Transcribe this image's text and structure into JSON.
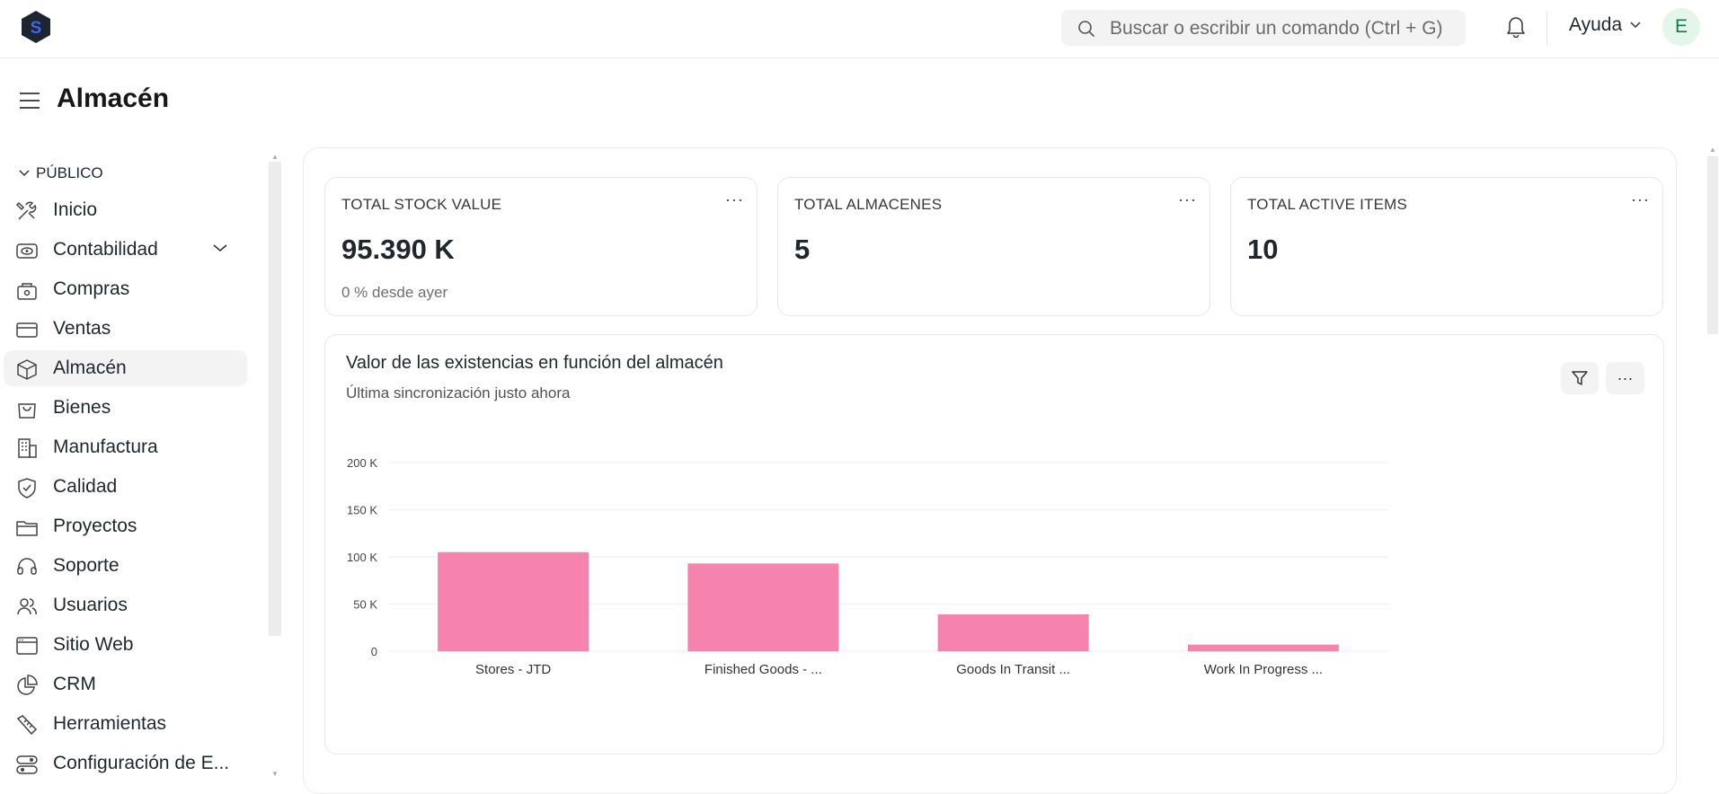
{
  "topbar": {
    "search_placeholder": "Buscar o escribir un comando (Ctrl + G)",
    "help_label": "Ayuda",
    "avatar_initial": "E"
  },
  "page": {
    "title": "Almacén"
  },
  "sidebar": {
    "section_label": "PÚBLICO",
    "items": [
      {
        "label": "Inicio",
        "icon": "tools-icon"
      },
      {
        "label": "Contabilidad",
        "icon": "eye-icon",
        "expandable": true
      },
      {
        "label": "Compras",
        "icon": "shopping-icon"
      },
      {
        "label": "Ventas",
        "icon": "card-icon"
      },
      {
        "label": "Almacén",
        "icon": "box-icon",
        "active": true
      },
      {
        "label": "Bienes",
        "icon": "bag-icon"
      },
      {
        "label": "Manufactura",
        "icon": "building-icon"
      },
      {
        "label": "Calidad",
        "icon": "shield-icon"
      },
      {
        "label": "Proyectos",
        "icon": "folder-icon"
      },
      {
        "label": "Soporte",
        "icon": "headset-icon"
      },
      {
        "label": "Usuarios",
        "icon": "users-icon"
      },
      {
        "label": "Sitio Web",
        "icon": "browser-icon"
      },
      {
        "label": "CRM",
        "icon": "pie-icon"
      },
      {
        "label": "Herramientas",
        "icon": "wrench-icon"
      },
      {
        "label": "Configuración de E...",
        "icon": "toggle-icon"
      }
    ]
  },
  "cards": [
    {
      "title": "TOTAL STOCK VALUE",
      "value": "95.390 K",
      "sub": "0 % desde ayer"
    },
    {
      "title": "TOTAL ALMACENES",
      "value": "5",
      "sub": ""
    },
    {
      "title": "TOTAL ACTIVE ITEMS",
      "value": "10",
      "sub": ""
    }
  ],
  "card_menu": "···",
  "chart": {
    "title": "Valor de las existencias en función del almacén",
    "subtitle": "Última sincronización justo ahora"
  },
  "chart_data": {
    "type": "bar",
    "categories": [
      "Stores - JTD",
      "Finished Goods - ...",
      "Goods In Transit ...",
      "Work In Progress ..."
    ],
    "values": [
      105000,
      93000,
      39000,
      7000
    ],
    "ylim": [
      0,
      200000
    ],
    "yticks": [
      0,
      50000,
      100000,
      150000,
      200000
    ],
    "ytick_labels": [
      "0",
      "50 K",
      "100 K",
      "150 K",
      "200 K"
    ],
    "color": "#f683ae",
    "grid": true
  }
}
